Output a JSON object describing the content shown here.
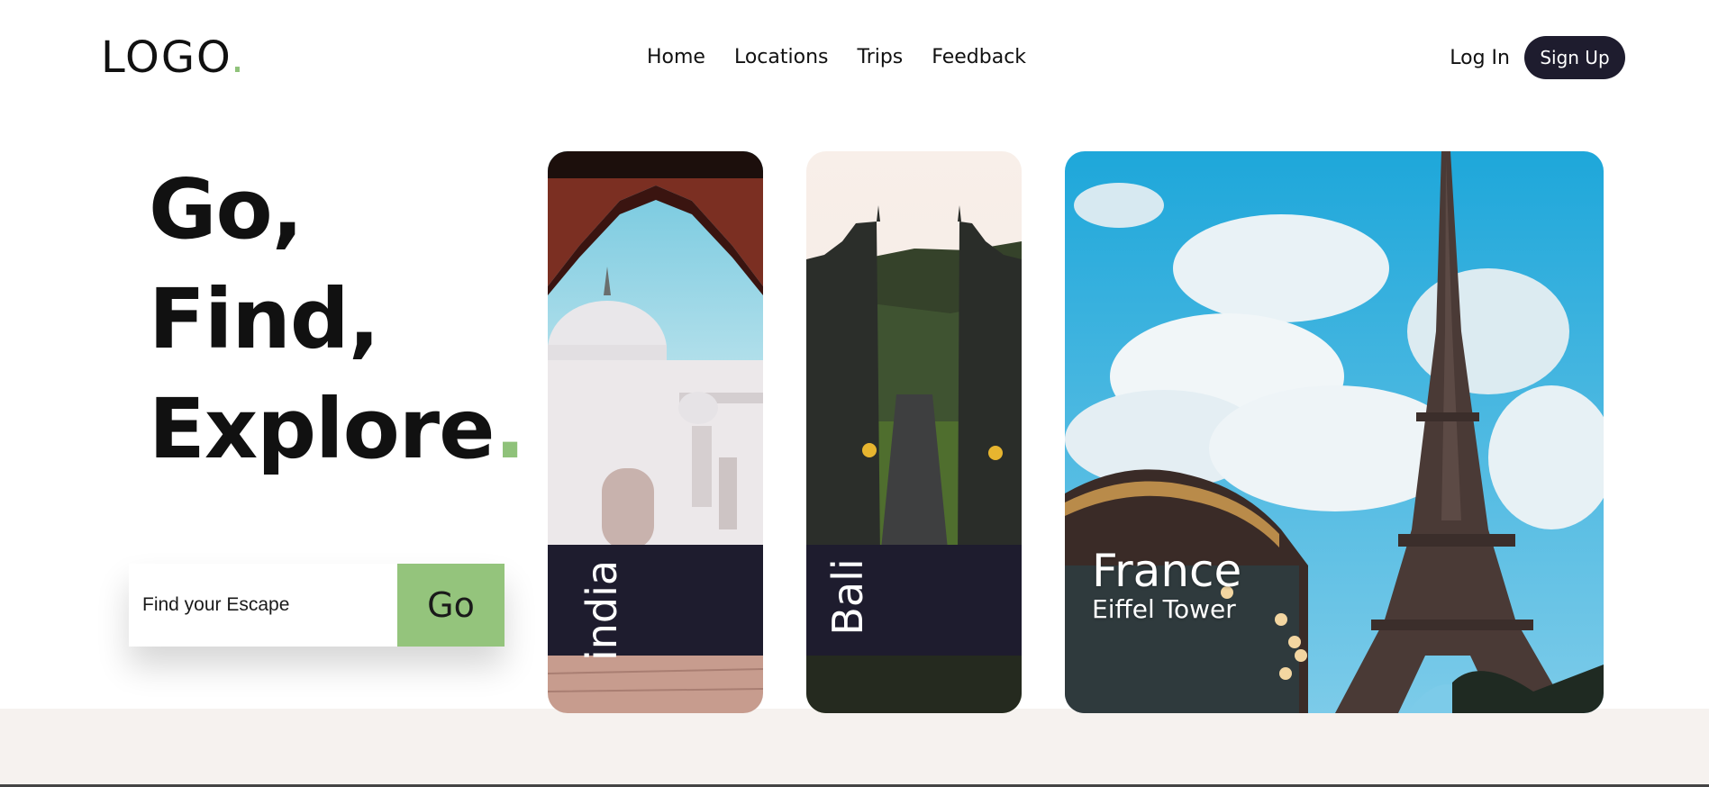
{
  "brand": {
    "logo_text": "LOGO",
    "logo_dot": ".",
    "accent_color": "#8fc27a",
    "dark_color": "#1e1c2e"
  },
  "nav": {
    "items": [
      "Home",
      "Locations",
      "Trips",
      "Feedback"
    ]
  },
  "auth": {
    "login_label": "Log In",
    "signup_label": "Sign Up"
  },
  "hero": {
    "line1": "Go,",
    "line2": "Find,",
    "line3": "Explore",
    "dot": "."
  },
  "search": {
    "placeholder": "Find your Escape",
    "button_label": "Go"
  },
  "cards": [
    {
      "label": "india",
      "image": "taj-mahal-photo"
    },
    {
      "label": "Bali",
      "image": "bali-temple-gate-photo"
    },
    {
      "title": "France",
      "subtitle": "Eiffel Tower",
      "image": "eiffel-tower-photo"
    }
  ]
}
